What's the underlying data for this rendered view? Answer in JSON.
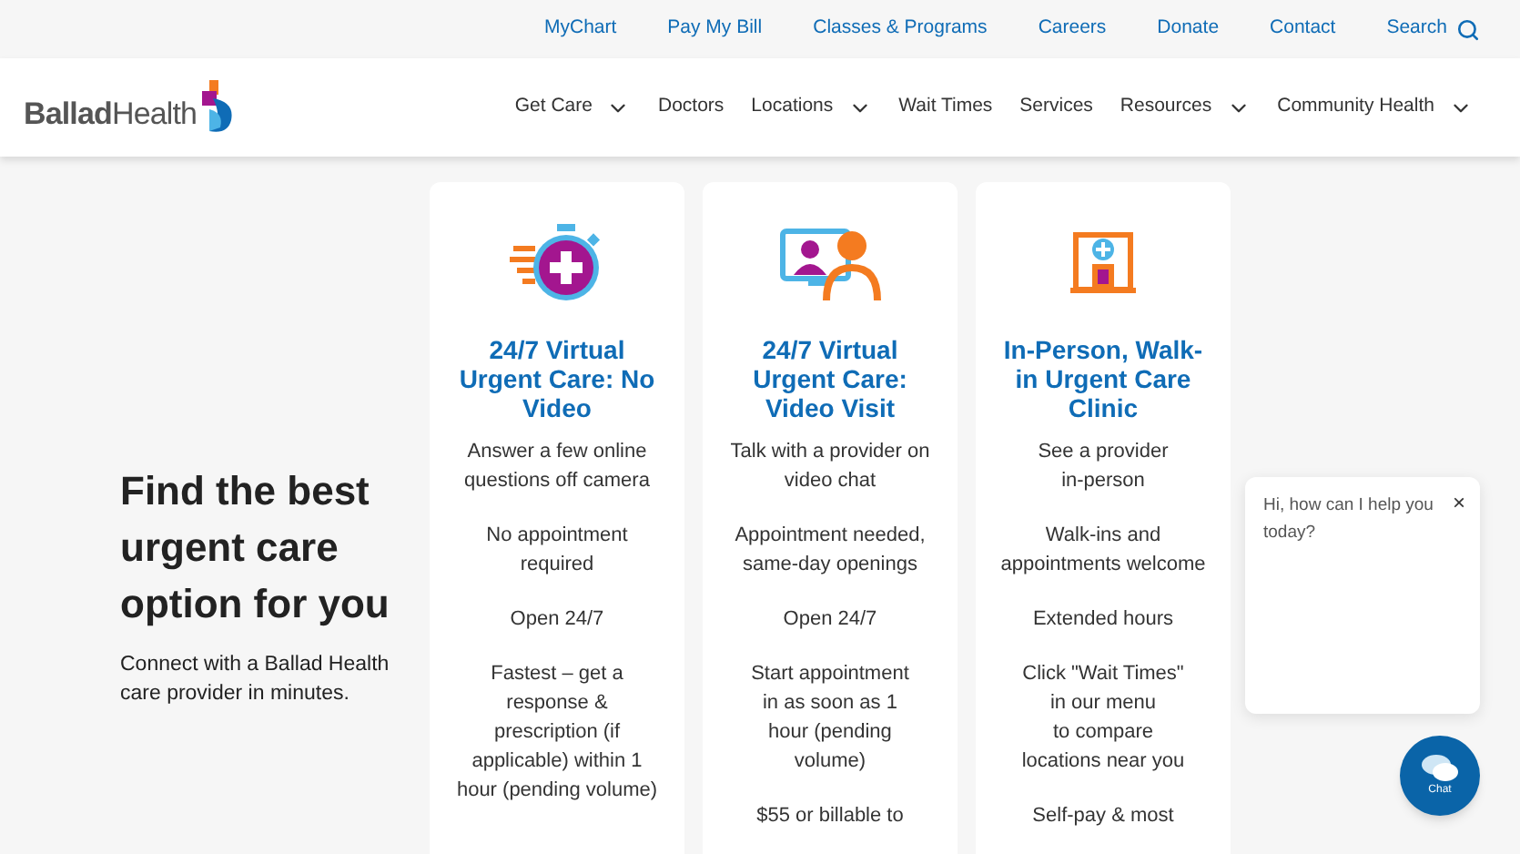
{
  "utility_nav": {
    "links": [
      "MyChart",
      "Pay My Bill",
      "Classes & Programs",
      "Careers",
      "Donate",
      "Contact"
    ],
    "search": "Search"
  },
  "header": {
    "logo": "**Ballad**Health",
    "nav": [
      {
        "label": "Get Care",
        "dropdown": true
      },
      {
        "label": "Doctors",
        "dropdown": false
      },
      {
        "label": "Locations",
        "dropdown": true
      },
      {
        "label": "Wait Times",
        "dropdown": false
      },
      {
        "label": "Services",
        "dropdown": false
      },
      {
        "label": "Resources",
        "dropdown": true
      },
      {
        "label": "Community Health",
        "dropdown": true
      }
    ]
  },
  "hero": {
    "heading": "Find the best urgent care option for you",
    "subtext": "Connect with a Ballad Health care provider in minutes."
  },
  "cards": [
    {
      "kind": "stopwatch",
      "title": "24/7 Virtual\nUrgent Care: No\nVideo",
      "items": [
        "Answer a few online\nquestions off camera",
        "No appointment\nrequired",
        "Open 24/7",
        "Fastest – get a\nresponse &\nprescription (if\napplicable) within 1\nhour (pending volume)"
      ]
    },
    {
      "kind": "video",
      "title": "24/7 Virtual\nUrgent Care:\nVideo Visit",
      "items": [
        "Talk with a provider on\nvideo chat",
        "Appointment needed,\nsame-day openings",
        "Open 24/7",
        "Start appointment\nin as soon as 1\nhour (pending\nvolume)",
        "$55 or billable to"
      ]
    },
    {
      "kind": "clinic",
      "title": "In-Person, Walk-\nin Urgent Care\nClinic",
      "items": [
        "See a provider\nin-person",
        "Walk-ins and\nappointments welcome",
        "Extended hours",
        "Click \"Wait Times\"\nin our menu\nto compare\nlocations near you",
        "Self-pay & most"
      ]
    }
  ],
  "chat_popup": {
    "message": "Hi, how can I help you today?",
    "close": "×"
  },
  "chat_button": {
    "label": "Chat"
  }
}
